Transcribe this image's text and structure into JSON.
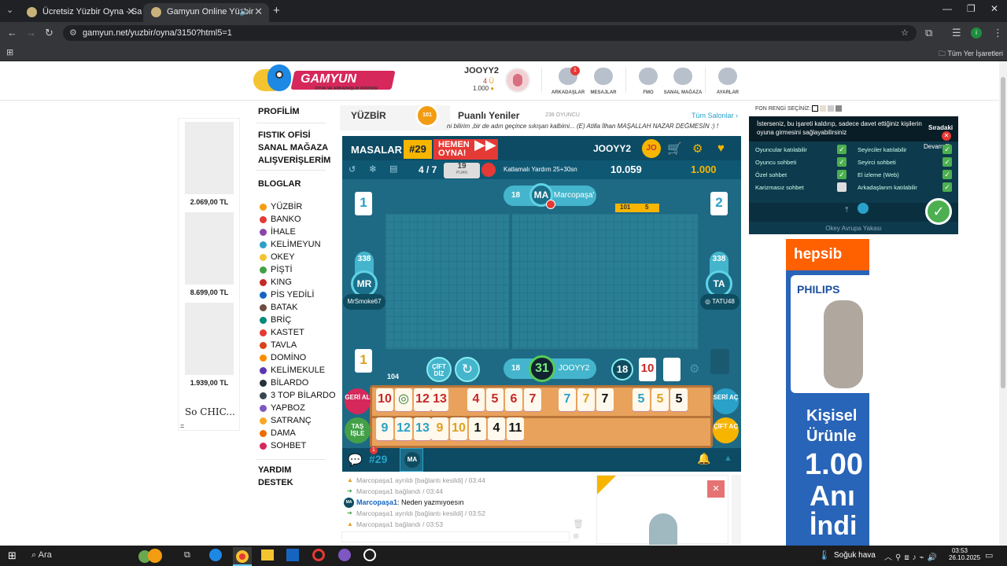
{
  "browser": {
    "tabs": [
      {
        "title": "Ücretsiz Yüzbir Oyna - Salon Lis"
      },
      {
        "title": "Gamyun Online Yüzbir"
      }
    ],
    "new_tab": "+",
    "url": "gamyun.net/yuzbir/oyna/3150?html5=1",
    "bookmarks_label": "Tüm Yer İşaretleri"
  },
  "header": {
    "logo_text": "GAMYUN",
    "logo_sub": "OYUN VE ARKADAŞLIK DÜNYASI",
    "username": "JOOYY2",
    "level": "4",
    "coins": "1.000",
    "icons": [
      {
        "label": "ARKADAŞLAR",
        "badge": "1"
      },
      {
        "label": "MESAJLAR"
      },
      {
        "label": "FMO"
      },
      {
        "label": "SANAL MAĞAZA"
      },
      {
        "label": "AYARLAR"
      }
    ]
  },
  "products": [
    {
      "price": "2.069,00 TL"
    },
    {
      "price": "8.699,00 TL"
    },
    {
      "price": "1.939,00 TL"
    }
  ],
  "brand": "So CHIC...",
  "nav": {
    "profile": "PROFİLİM",
    "shop1": "FISTIK OFİSİ",
    "shop2": "SANAL MAĞAZA",
    "shop3": "ALIŞVERİŞLERİM",
    "blogs": "BLOGLAR",
    "games": [
      "YÜZBİR",
      "BANKO",
      "İHALE",
      "KELİMEYUN",
      "OKEY",
      "PİŞTİ",
      "KING",
      "PİS YEDİLİ",
      "BATAK",
      "BRİÇ",
      "KASTET",
      "TAVLA",
      "DOMİNO",
      "KELİMEKULE",
      "BİLARDO",
      "3 TOP BİLARDO",
      "YAPBOZ",
      "SATRANÇ",
      "DAMA",
      "SOHBET"
    ],
    "help": "YARDIM",
    "support": "DESTEK"
  },
  "game": {
    "title": "YÜZBİR",
    "news_title": "Puanlı Yeniler",
    "players_online": "238 OYUNCU",
    "all_rooms": "Tüm Salonlar ›",
    "ticker": "ni bilirim ,bir de adın geçince sıkışan kalbimi... (E) Atilla İlhan MAŞALLAH NAZAR DEĞMESİN :) !",
    "masalar": "MASALAR",
    "table_no": "#29",
    "play_now": "HEMEN OYNA!",
    "me": "JOOYY2",
    "me_initials": "JO",
    "round": "4 / 7",
    "points": "19",
    "points_label": "PUAN",
    "mode": "Katlamalı Yardım 25+30sn",
    "chips": "10.059",
    "gold": "1.000",
    "opp_top": {
      "name": "Marcopaşa'",
      "initials": "MA",
      "count": "18"
    },
    "opp_left": {
      "name": "MrSmoke67",
      "initials": "MR",
      "score": "338"
    },
    "opp_right": {
      "name": "TATU48",
      "initials": "TA",
      "score": "338"
    },
    "discard_top_left": "1",
    "discard_top_right": "2",
    "discard_bottom_left": "1",
    "laid": [
      "101",
      "5"
    ],
    "pile": "104",
    "cift_diz": "ÇİFT DİZ",
    "self_count": "18",
    "self_timer": "31",
    "self_name": "JOOYY2",
    "indicator_count": "18",
    "indicator_tile": "10",
    "rack_row1": [
      {
        "v": "10",
        "c": "#c62828"
      },
      {
        "v": "◎",
        "c": "#2e7d32"
      },
      {
        "v": "12",
        "c": "#c62828"
      },
      {
        "v": "13",
        "c": "#c62828"
      },
      {
        "v": "4",
        "c": "#c62828"
      },
      {
        "v": "5",
        "c": "#c62828"
      },
      {
        "v": "6",
        "c": "#c62828"
      },
      {
        "v": "7",
        "c": "#c62828"
      },
      {
        "v": "7",
        "c": "#2aa1c8"
      },
      {
        "v": "7",
        "c": "#e0a020"
      },
      {
        "v": "7",
        "c": "#111111"
      },
      {
        "v": "5",
        "c": "#2aa1c8"
      },
      {
        "v": "5",
        "c": "#e0a020"
      },
      {
        "v": "5",
        "c": "#111111"
      }
    ],
    "rack_row2": [
      {
        "v": "9",
        "c": "#2aa1c8"
      },
      {
        "v": "12",
        "c": "#2aa1c8"
      },
      {
        "v": "13",
        "c": "#2aa1c8"
      },
      {
        "v": "9",
        "c": "#e0a020"
      },
      {
        "v": "10",
        "c": "#e0a020"
      },
      {
        "v": "1",
        "c": "#111111"
      },
      {
        "v": "4",
        "c": "#111111"
      },
      {
        "v": "11",
        "c": "#111111"
      }
    ],
    "btn_geri": "GERİ AL",
    "btn_tas": "TAŞ İŞLE",
    "btn_seri": "SERİ AÇ",
    "btn_cift": "ÇİFT AÇ",
    "chat_tab": "#29",
    "chat_badge": "1",
    "chat_ma": "MA",
    "chat": [
      {
        "type": "sys",
        "text": "Marcopaşa1 ayrıldı [bağlantı kesildi] / 03:44"
      },
      {
        "type": "sys",
        "text": "Marcopaşa1 bağlandı / 03:44"
      },
      {
        "type": "msg",
        "user": "Marcopaşa1",
        "text": ": Neden yazmıyoesın"
      },
      {
        "type": "sys",
        "text": "Marcopaşa1 ayrıldı [bağlantı kesildi] / 03:52"
      },
      {
        "type": "sys",
        "text": "Marcopaşa1 bağlandı / 03:53"
      }
    ]
  },
  "settings": {
    "fon_label": "FON RENGİ SEÇİNİZ:",
    "tip": "İsterseniz, bu işareti kaldırıp, sadece davet ettiğiniz kişilerin oyuna girmesini sağlayabilirsiniz",
    "next": "Sıradaki",
    "continue": "Devam Et",
    "left": [
      "Oyuncular katılabilir",
      "Oyuncu sohbeti",
      "Özel sohbet",
      "Karizmasız sohbet"
    ],
    "right": [
      "Seyirciler katılabilir",
      "Seyirci sohbeti",
      "El izleme (Web)",
      "Arkadaşlarım katılabilir"
    ],
    "table_name": "Okey Avrupa Yakası"
  },
  "ad": {
    "brand": "hepsib",
    "product": "PHILIPS",
    "line1": "Kişisel",
    "line2": "Ürünle",
    "line3": "1.00",
    "line4": "Anı",
    "line5": "İndi"
  },
  "taskbar": {
    "search": "Ara",
    "weather": "Soğuk hava",
    "time": "03:53",
    "date": "26.10.2025"
  }
}
